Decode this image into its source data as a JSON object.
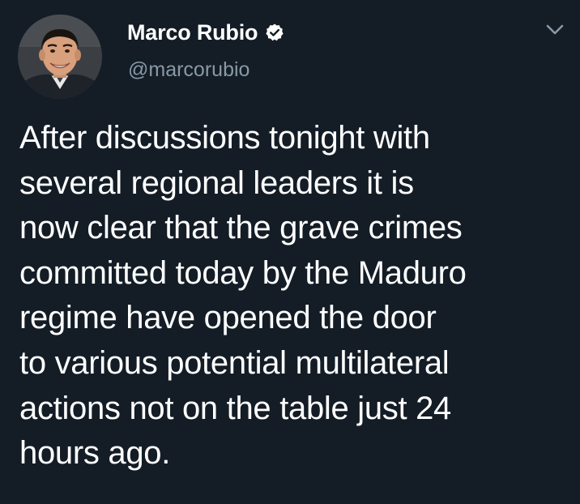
{
  "author": {
    "display_name": "Marco Rubio",
    "handle": "@marcorubio",
    "verified": true,
    "avatar_icon": "profile-photo"
  },
  "tweet": {
    "text": "After discussions tonight with\nseveral regional leaders it is\nnow clear that the grave crimes\ncommitted today by the Maduro\nregime have opened the door\nto various potential multilateral\nactions not on the table just 24\nhours ago."
  },
  "menu": {
    "icon": "chevron-down-icon"
  },
  "colors": {
    "background": "#141d26",
    "primary_text": "#ffffff",
    "secondary_text": "#8899a6",
    "verified_badge": "#ffffff"
  }
}
